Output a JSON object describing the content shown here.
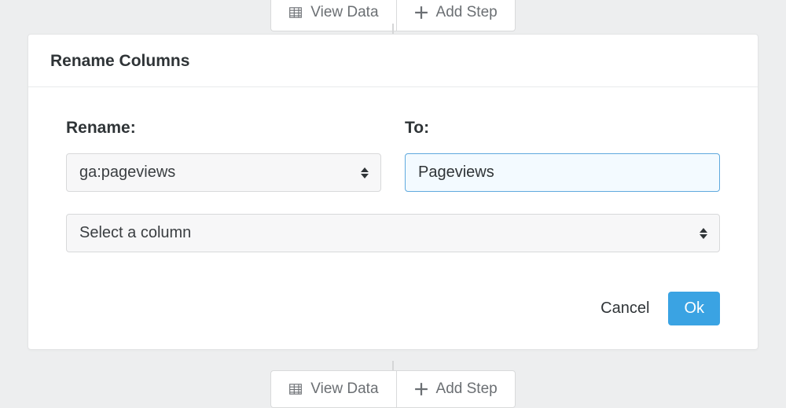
{
  "toolbar": {
    "view_data_label": "View Data",
    "add_step_label": "Add Step"
  },
  "panel": {
    "title": "Rename Columns",
    "rename_label": "Rename:",
    "to_label": "To:",
    "rename_select_value": "ga:pageviews",
    "to_input_value": "Pageviews",
    "full_select_placeholder": "Select a column",
    "cancel_label": "Cancel",
    "ok_label": "Ok"
  }
}
